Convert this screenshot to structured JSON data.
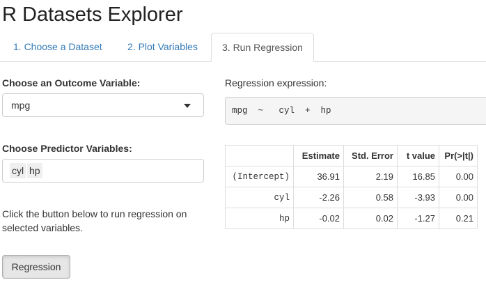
{
  "app": {
    "title": "R Datasets Explorer"
  },
  "tabs": [
    {
      "label": "1. Choose a Dataset",
      "active": false
    },
    {
      "label": "2. Plot Variables",
      "active": false
    },
    {
      "label": "3. Run Regression",
      "active": true
    }
  ],
  "outcome": {
    "label": "Choose an Outcome Variable:",
    "value": "mpg"
  },
  "predictors": {
    "label": "Choose Predictor Variables:",
    "selected": [
      "cyl",
      "hp"
    ]
  },
  "help_text": "Click the button below to run regression on selected variables.",
  "run_button": {
    "label": "Regression"
  },
  "regression": {
    "expression_label": "Regression expression:",
    "expression": "mpg  ~   cyl  +  hp",
    "table": {
      "headers": [
        "",
        "Estimate",
        "Std. Error",
        "t value",
        "Pr(>|t|)"
      ],
      "rows": [
        {
          "term": "(Intercept)",
          "estimate": "36.91",
          "std_error": "2.19",
          "t_value": "16.85",
          "p_value": "0.00"
        },
        {
          "term": "cyl",
          "estimate": "-2.26",
          "std_error": "0.58",
          "t_value": "-3.93",
          "p_value": "0.00"
        },
        {
          "term": "hp",
          "estimate": "-0.02",
          "std_error": "0.02",
          "t_value": "-1.27",
          "p_value": "0.21"
        }
      ]
    }
  },
  "colors": {
    "link": "#337ab7",
    "border": "#dddddd",
    "well": "#f5f5f5",
    "button": "#e6e6e6"
  },
  "icons": {
    "select_caret": "caret-down-icon"
  }
}
